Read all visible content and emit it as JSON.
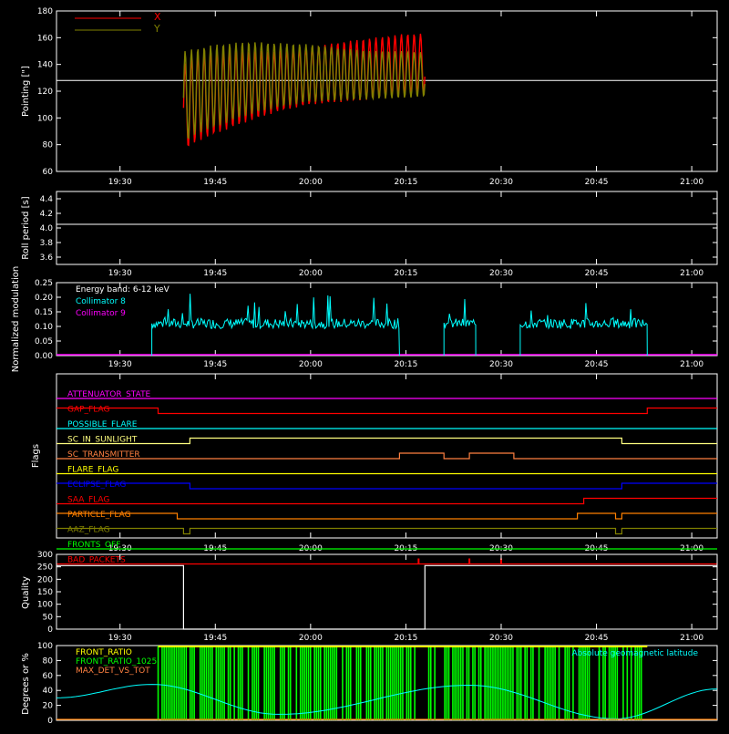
{
  "x_ticks": [
    "19:30",
    "19:45",
    "20:00",
    "20:15",
    "20:30",
    "20:45",
    "21:00"
  ],
  "colors": {
    "axes": "#ffffff",
    "x": "#ff0000",
    "y": "#808000",
    "cyan": "#00ffff",
    "magenta": "#ff00ff",
    "green": "#00ff00",
    "yellow": "#ffff00",
    "orange": "#ff8000",
    "blue": "#0000ff"
  },
  "chart_data": [
    {
      "id": "pointing",
      "type": "area",
      "ylabel": "Pointing [\"]",
      "ylim": [
        60,
        180
      ],
      "yticks": [
        60,
        80,
        100,
        120,
        140,
        160,
        180
      ],
      "xlim": [
        "19:20",
        "21:04"
      ],
      "reference_line": 128,
      "legend": [
        "X",
        "Y"
      ],
      "series": [
        {
          "name": "X",
          "x": [
            "19:40",
            "19:42",
            "19:45",
            "19:50",
            "19:55",
            "20:00",
            "20:05",
            "20:10",
            "20:15",
            "20:18"
          ],
          "min": [
            75,
            82,
            88,
            97,
            105,
            110,
            112,
            114,
            117,
            118
          ],
          "max": [
            140,
            148,
            150,
            150,
            150,
            153,
            157,
            160,
            163,
            163
          ]
        },
        {
          "name": "Y",
          "x": [
            "19:40",
            "19:42",
            "19:45",
            "19:50",
            "19:55",
            "20:00",
            "20:05",
            "20:10",
            "20:15",
            "20:18"
          ],
          "min": [
            80,
            88,
            93,
            102,
            108,
            112,
            113,
            114,
            115,
            116
          ],
          "max": [
            150,
            152,
            155,
            157,
            156,
            155,
            152,
            150,
            150,
            149
          ]
        }
      ]
    },
    {
      "id": "roll",
      "type": "line",
      "ylabel": "Roll period [s]",
      "ylim": [
        3.5,
        4.5
      ],
      "yticks": [
        "3.6",
        "3.8",
        "4.0",
        "4.2",
        "4.4"
      ],
      "series": [
        {
          "x": [
            "19:20",
            "21:04"
          ],
          "y": [
            4.05,
            4.05
          ]
        }
      ]
    },
    {
      "id": "modulation",
      "type": "line",
      "ylabel": "Normalized modulation",
      "ylim": [
        0,
        0.25
      ],
      "yticks": [
        "0.00",
        "0.05",
        "0.10",
        "0.15",
        "0.20",
        "0.25"
      ],
      "legend": [
        "Energy band: 6-12 keV",
        "Collimator 8",
        "Collimator 9"
      ],
      "series": [
        {
          "name": "Collimator 8",
          "segments": [
            [
              "19:35",
              "20:14"
            ],
            [
              "20:21",
              "20:26"
            ],
            [
              "20:33",
              "20:53"
            ]
          ],
          "typical": 0.11,
          "peak": 0.22
        },
        {
          "name": "Collimator 9",
          "x": [
            "19:20",
            "21:04"
          ],
          "y": [
            0,
            0
          ]
        }
      ]
    },
    {
      "id": "flags",
      "type": "line",
      "ylabel": "Flags",
      "flags": [
        {
          "name": "ATTENUATOR_STATE",
          "color": "#ff00ff",
          "steps": [
            [
              "19:20",
              0
            ]
          ]
        },
        {
          "name": "GAP_FLAG",
          "color": "#ff0000",
          "steps": [
            [
              "19:20",
              1
            ],
            [
              "19:36",
              0
            ],
            [
              "20:53",
              1
            ]
          ]
        },
        {
          "name": "POSSIBLE_FLARE",
          "color": "#00ffff",
          "steps": [
            [
              "19:20",
              0
            ]
          ]
        },
        {
          "name": "SC_IN_SUNLIGHT",
          "color": "#ffff80",
          "steps": [
            [
              "19:20",
              0
            ],
            [
              "19:41",
              1
            ],
            [
              "20:49",
              0
            ]
          ]
        },
        {
          "name": "SC_TRANSMITTER",
          "color": "#ff8040",
          "steps": [
            [
              "19:20",
              0
            ],
            [
              "20:14",
              1
            ],
            [
              "20:21",
              0
            ],
            [
              "20:25",
              1
            ],
            [
              "20:32",
              0
            ]
          ]
        },
        {
          "name": "FLARE_FLAG",
          "color": "#ffff00",
          "steps": [
            [
              "19:20",
              0
            ]
          ]
        },
        {
          "name": "ECLIPSE_FLAG",
          "color": "#0000ff",
          "steps": [
            [
              "19:20",
              1
            ],
            [
              "19:41",
              0
            ],
            [
              "20:49",
              1
            ]
          ]
        },
        {
          "name": "SAA_FLAG",
          "color": "#ff0000",
          "steps": [
            [
              "19:20",
              0
            ],
            [
              "20:43",
              1
            ]
          ]
        },
        {
          "name": "PARTICLE_FLAG",
          "color": "#ff8000",
          "steps": [
            [
              "19:20",
              1
            ],
            [
              "19:39",
              0
            ],
            [
              "20:42",
              1
            ],
            [
              "20:48",
              0
            ],
            [
              "20:49",
              1
            ]
          ]
        },
        {
          "name": "AAZ_FLAG",
          "color": "#808000",
          "steps": [
            [
              "19:20",
              1
            ],
            [
              "19:40",
              0
            ],
            [
              "19:41",
              1
            ],
            [
              "20:48",
              0
            ],
            [
              "20:49",
              1
            ]
          ]
        },
        {
          "name": "FRONTS_OFF",
          "color": "#00ff00",
          "steps": [
            [
              "19:20",
              0
            ]
          ]
        },
        {
          "name": "BAD_PACKETS",
          "color": "#ff0000",
          "steps": [
            [
              "19:20",
              0
            ]
          ],
          "spikes": [
            "20:17",
            "20:25",
            "20:30"
          ]
        }
      ]
    },
    {
      "id": "quality",
      "type": "line",
      "ylabel": "Quality",
      "ylim": [
        0,
        300
      ],
      "yticks": [
        0,
        50,
        100,
        150,
        200,
        250,
        300
      ],
      "series": [
        {
          "x": [
            "19:20",
            "19:40",
            "19:40",
            "20:18",
            "20:18",
            "21:04"
          ],
          "y": [
            255,
            255,
            0,
            0,
            255,
            255
          ]
        }
      ]
    },
    {
      "id": "degrees",
      "type": "bar",
      "ylabel": "Degrees or %",
      "ylim": [
        0,
        100
      ],
      "yticks": [
        0,
        20,
        40,
        60,
        80,
        100
      ],
      "legend": [
        "FRONT_RATIO",
        "FRONT_RATIO_1025",
        "MAX_DET_VS_TOT",
        "Absolute geomagnetic latitude"
      ],
      "series": [
        {
          "name": "FRONT_RATIO_1025",
          "segments": [
            [
              "19:36",
              "20:53"
            ]
          ],
          "value": 100
        },
        {
          "name": "Absolute geomagnetic latitude",
          "x": [
            "19:20",
            "19:35",
            "19:55",
            "20:25",
            "20:48",
            "21:04"
          ],
          "y": [
            30,
            48,
            8,
            47,
            2,
            42
          ]
        }
      ]
    }
  ]
}
